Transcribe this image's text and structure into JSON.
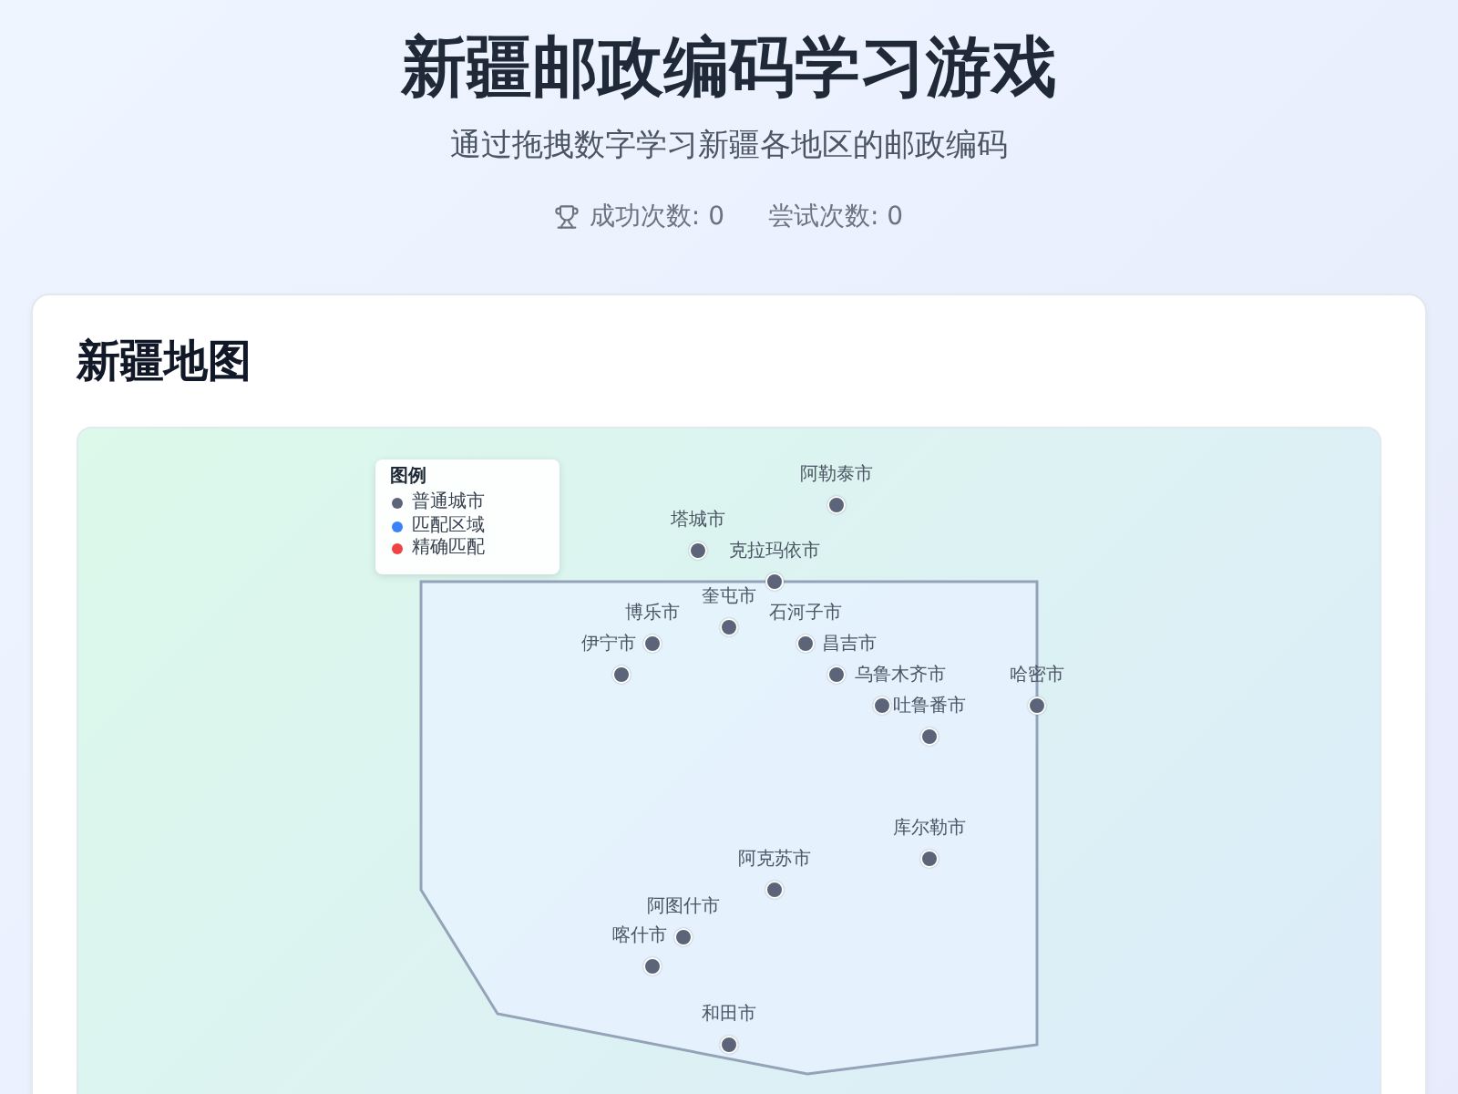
{
  "header": {
    "title": "新疆邮政编码学习游戏",
    "subtitle": "通过拖拽数字学习新疆各地区的邮政编码",
    "success": "成功次数: 0",
    "attempts": "尝试次数: 0"
  },
  "map": {
    "title": "新疆地图",
    "legend": {
      "title": "图例",
      "items": [
        {
          "label": "普通城市",
          "color": "#5b6479"
        },
        {
          "label": "匹配区域",
          "color": "#3b82f6"
        },
        {
          "label": "精确匹配",
          "color": "#ef4444"
        }
      ]
    },
    "cities": [
      {
        "name": "阿勒泰市"
      },
      {
        "name": "塔城市"
      },
      {
        "name": "克拉玛依市"
      },
      {
        "name": "奎屯市"
      },
      {
        "name": "博乐市"
      },
      {
        "name": "石河子市"
      },
      {
        "name": "伊宁市"
      },
      {
        "name": "昌吉市"
      },
      {
        "name": "乌鲁木齐市"
      },
      {
        "name": "哈密市"
      },
      {
        "name": "吐鲁番市"
      },
      {
        "name": "库尔勒市"
      },
      {
        "name": "阿克苏市"
      },
      {
        "name": "阿图什市"
      },
      {
        "name": "喀什市"
      },
      {
        "name": "和田市"
      }
    ]
  }
}
